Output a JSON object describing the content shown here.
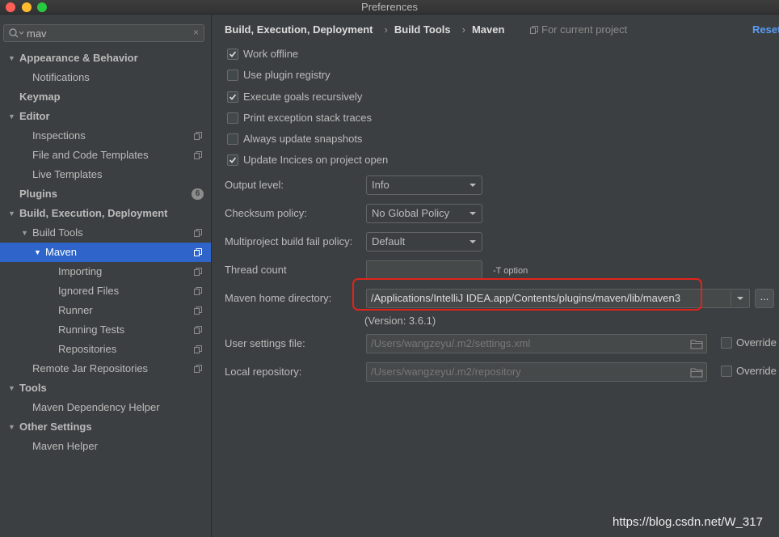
{
  "window": {
    "title": "Preferences"
  },
  "search": {
    "value": "mav",
    "clear_glyph": "×"
  },
  "tree": [
    {
      "label": "Appearance & Behavior",
      "bold": true,
      "arrow": "▼"
    },
    {
      "label": "Notifications"
    },
    {
      "label": "Keymap",
      "bold": true
    },
    {
      "label": "Editor",
      "bold": true,
      "arrow": "▼"
    },
    {
      "label": "Inspections",
      "icon": "project-icon"
    },
    {
      "label": "File and Code Templates",
      "icon": "project-icon"
    },
    {
      "label": "Live Templates"
    },
    {
      "label": "Plugins",
      "bold": true,
      "badge": "6"
    },
    {
      "label": "Build, Execution, Deployment",
      "bold": true,
      "arrow": "▼"
    },
    {
      "label": "Build Tools",
      "arrow": "▼",
      "icon": "project-icon"
    },
    {
      "label": "Maven",
      "arrow": "▼",
      "icon": "project-icon",
      "selected": true
    },
    {
      "label": "Importing",
      "icon": "project-icon"
    },
    {
      "label": "Ignored Files",
      "icon": "project-icon"
    },
    {
      "label": "Runner",
      "icon": "project-icon"
    },
    {
      "label": "Running Tests",
      "icon": "project-icon"
    },
    {
      "label": "Repositories",
      "icon": "project-icon"
    },
    {
      "label": "Remote Jar Repositories",
      "icon": "project-icon"
    },
    {
      "label": "Tools",
      "bold": true,
      "arrow": "▼"
    },
    {
      "label": "Maven Dependency Helper"
    },
    {
      "label": "Other Settings",
      "bold": true,
      "arrow": "▼"
    },
    {
      "label": "Maven Helper"
    }
  ],
  "breadcrumb": {
    "items": [
      "Build, Execution, Deployment",
      "Build Tools",
      "Maven"
    ],
    "separator": "›",
    "scope": "For current project",
    "reset": "Reset"
  },
  "options": [
    {
      "label": "Work offline",
      "checked": true
    },
    {
      "label": "Use plugin registry",
      "checked": false
    },
    {
      "label": "Execute goals recursively",
      "checked": true
    },
    {
      "label": "Print exception stack traces",
      "checked": false
    },
    {
      "label": "Always update snapshots",
      "checked": false
    },
    {
      "label": "Update Incices on project open",
      "checked": true
    }
  ],
  "fields": {
    "output_level": {
      "label": "Output level:",
      "value": "Info"
    },
    "checksum_policy": {
      "label": "Checksum policy:",
      "value": "No Global Policy"
    },
    "fail_policy": {
      "label": "Multiproject build fail policy:",
      "value": "Default"
    },
    "thread_count": {
      "label": "Thread count",
      "value": "",
      "hint": "-T option"
    },
    "maven_home": {
      "label": "Maven home directory:",
      "value": "/Applications/IntelliJ IDEA.app/Contents/plugins/maven/lib/maven3",
      "browse": "...",
      "version": "(Version: 3.6.1)"
    },
    "user_settings": {
      "label": "User settings file:",
      "value": "/Users/wangzeyu/.m2/settings.xml",
      "override": "Override"
    },
    "local_repo": {
      "label": "Local repository:",
      "value": "/Users/wangzeyu/.m2/repository",
      "override": "Override"
    }
  },
  "watermark": "https://blog.csdn.net/W_317",
  "colors": {
    "accent": "#2f65ca",
    "highlight": "#e0241b",
    "link": "#589df6"
  }
}
